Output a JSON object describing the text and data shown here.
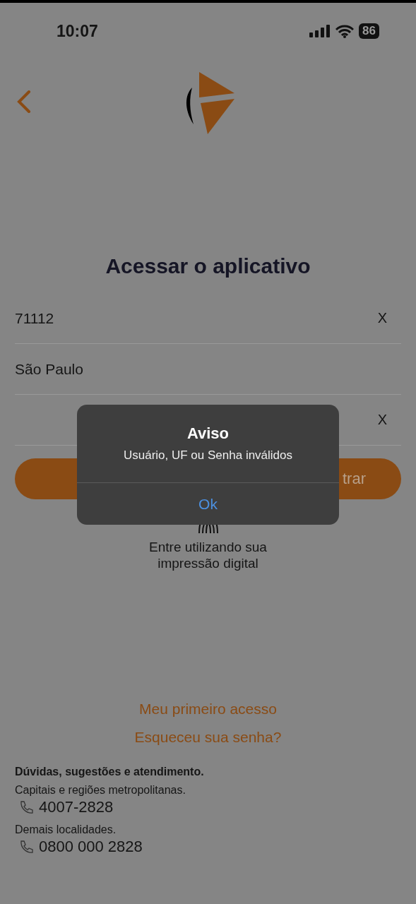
{
  "status_bar": {
    "time": "10:07",
    "battery": "86"
  },
  "title": "Acessar o aplicativo",
  "fields": [
    {
      "value": "71112",
      "clear": "X"
    },
    {
      "value": "São Paulo"
    },
    {
      "clear": "X"
    }
  ],
  "login_button": {
    "label": "trar"
  },
  "fingerprint": {
    "caption": "Entre utilizando sua impressão digital"
  },
  "links": [
    "Meu primeiro acesso",
    "Esqueceu sua senha?"
  ],
  "support": {
    "heading": "Dúvidas, sugestões e atendimento.",
    "contacts": [
      {
        "region": "Capitais e regiões metropolitanas.",
        "phone": "4007-2828"
      },
      {
        "region": "Demais localidades.",
        "phone": "0800 000 2828"
      }
    ]
  },
  "alert": {
    "title": "Aviso",
    "message": "Usuário, UF ou Senha inválidos",
    "button": "Ok"
  }
}
